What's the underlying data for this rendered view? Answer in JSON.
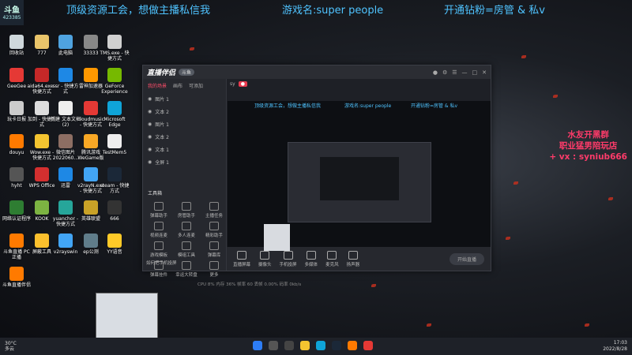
{
  "overlay": {
    "line1": "顶级资源工会，想做主播私信我",
    "line2": "游戏名:super people",
    "line3": "开通钻粉=房管 & 私v"
  },
  "promo": {
    "line1": "水友开黑群",
    "line2": "职业猛男陪玩店",
    "line3": "+ vx :  syniub666"
  },
  "streamer_badge": "423385",
  "desktop_icons": [
    {
      "label": "回收站",
      "color": "#cfd8dc"
    },
    {
      "label": "777",
      "color": "#e9c46a"
    },
    {
      "label": "此电脑",
      "color": "#4fa3e0"
    },
    {
      "label": "33333",
      "color": "#888888"
    },
    {
      "label": "TMS.exe - 快捷方式",
      "color": "#d0d0d0"
    },
    {
      "label": "GeeGee",
      "color": "#e53935"
    },
    {
      "label": "aida64.exe - 快捷方式",
      "color": "#c62828"
    },
    {
      "label": "ssr - 快捷方式",
      "color": "#1e88e5"
    },
    {
      "label": "雷神加速器",
      "color": "#ff9800"
    },
    {
      "label": "GeForce Experience",
      "color": "#76b900"
    },
    {
      "label": "玩卡日报",
      "color": "#cccccc"
    },
    {
      "label": "加到 - 快捷方式",
      "color": "#dddddd"
    },
    {
      "label": "新建 文本文档 (2)",
      "color": "#eeeeee"
    },
    {
      "label": "cloudmusic - 快捷方式",
      "color": "#e53935"
    },
    {
      "label": "Microsoft Edge",
      "color": "#0fa4d8"
    },
    {
      "label": "douyu",
      "color": "#ff7a00"
    },
    {
      "label": "Wow.exe - 快捷方式",
      "color": "#f4c430"
    },
    {
      "label": "微信图片 2022060...",
      "color": "#8d6e63"
    },
    {
      "label": "腾讯游戏 WeGame版",
      "color": "#f9a825"
    },
    {
      "label": "TestMem5",
      "color": "#eeeeee"
    },
    {
      "label": "hyht",
      "color": "#555555"
    },
    {
      "label": "WPS Office",
      "color": "#d32f2f"
    },
    {
      "label": "迅雷",
      "color": "#1e88e5"
    },
    {
      "label": "v2rayN.exe - 快捷方式",
      "color": "#42a5f5"
    },
    {
      "label": "steam - 快捷方式",
      "color": "#1b2838"
    },
    {
      "label": "网络认证程序",
      "color": "#2e7d32"
    },
    {
      "label": "KOOK",
      "color": "#7cb342"
    },
    {
      "label": "yuanchor - 快捷方式",
      "color": "#26a69a"
    },
    {
      "label": "英雄联盟",
      "color": "#c9a227"
    },
    {
      "label": "666",
      "color": "#333333"
    },
    {
      "label": "斗鱼直播 PC正播",
      "color": "#ff7a00"
    },
    {
      "label": "屏蔽工具",
      "color": "#fbc02d"
    },
    {
      "label": "v2rayswin",
      "color": "#42a5f5"
    },
    {
      "label": "ep公测",
      "color": "#607d8b"
    },
    {
      "label": "YY语音",
      "color": "#ffca28"
    },
    {
      "label": "斗鱼直播伴侣",
      "color": "#ff7a00"
    }
  ],
  "app": {
    "logo": "直播伴侣",
    "version_badge": "斗鱼",
    "tabs": [
      "我的场景",
      "画布",
      "可添加"
    ],
    "scenes": [
      "图片 1",
      "文本 2",
      "图片 1",
      "文本 2",
      "文本 1",
      "全屏 1"
    ],
    "room_prefix": "sy",
    "tools_label": "工具箱",
    "tools": [
      "弹幕助手",
      "房管助手",
      "主播任务",
      "视频连麦",
      "多人连麦",
      "精彩助手",
      "游戏模板",
      "模组工具",
      "弹幕库",
      "弹幕挂件",
      "幸运大转盘",
      "更多"
    ],
    "notice": "如何把手机投屏",
    "bottom_buttons": [
      "直播屏幕",
      "摄像头",
      "手机投屏",
      "多媒体",
      "麦克风",
      "扬声器"
    ],
    "start_live": "开始直播",
    "status": "CPU 8%  内存 36%  帧率 60  丢帧 0.00%  码率 0kb/s"
  },
  "taskbar": {
    "weather_temp": "30°C",
    "weather_desc": "多云",
    "time": "17:03",
    "date": "2022/8/28"
  }
}
